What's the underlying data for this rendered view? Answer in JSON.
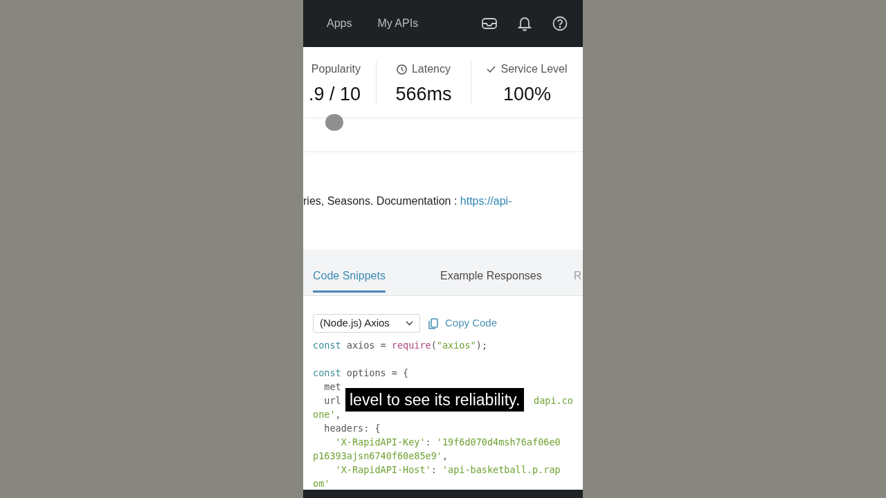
{
  "nav": {
    "links": [
      "Apps",
      "My APIs"
    ]
  },
  "stats": [
    {
      "kind": "plain",
      "label": "Popularity",
      "value": ".9 / 10"
    },
    {
      "kind": "clock",
      "label": "Latency",
      "value": "566ms"
    },
    {
      "kind": "check",
      "label": "Service Level",
      "value": "100%"
    }
  ],
  "description": {
    "text": "ries, Seasons. Documentation : ",
    "link": "https://api-"
  },
  "tabs": [
    {
      "label": "Code Snippets",
      "selected": true
    },
    {
      "label": "Example Responses",
      "selected": false
    },
    {
      "label": "R",
      "selected": false
    }
  ],
  "language_select": {
    "value": "(Node.js) Axios"
  },
  "copy_button": "Copy Code",
  "code_lines": [
    {
      "kind": "code",
      "segments": [
        {
          "kind": "keyword",
          "text": "const"
        },
        {
          "kind": "plain",
          "text": " axios = "
        },
        {
          "kind": "function",
          "text": "require"
        },
        {
          "kind": "plain",
          "text": "("
        },
        {
          "kind": "string",
          "text": "\"axios\""
        },
        {
          "kind": "plain",
          "text": ");"
        }
      ]
    },
    {
      "kind": "blank"
    },
    {
      "kind": "code",
      "segments": [
        {
          "kind": "keyword",
          "text": "const"
        },
        {
          "kind": "plain",
          "text": " options = {"
        }
      ]
    },
    {
      "kind": "code",
      "segments": [
        {
          "kind": "plain",
          "text": "  met"
        }
      ]
    },
    {
      "kind": "split",
      "segments": [
        {
          "kind": "plain",
          "text": "  url"
        },
        {
          "kind": "string",
          "text": "dapi.co"
        }
      ]
    },
    {
      "kind": "code",
      "segments": [
        {
          "kind": "string",
          "text": "one'"
        },
        {
          "kind": "plain",
          "text": ","
        }
      ]
    },
    {
      "kind": "code",
      "segments": [
        {
          "kind": "plain",
          "text": "  headers: {"
        }
      ]
    },
    {
      "kind": "code",
      "segments": [
        {
          "kind": "string",
          "text": "    'X-RapidAPI-Key'"
        },
        {
          "kind": "plain",
          "text": ": "
        },
        {
          "kind": "string",
          "text": "'19f6d070d4msh76af06e0"
        }
      ]
    },
    {
      "kind": "code",
      "segments": [
        {
          "kind": "string",
          "text": "p16393ajsn6740f60e85e9'"
        },
        {
          "kind": "plain",
          "text": ","
        }
      ]
    },
    {
      "kind": "code",
      "segments": [
        {
          "kind": "string",
          "text": "    'X-RapidAPI-Host'"
        },
        {
          "kind": "plain",
          "text": ": "
        },
        {
          "kind": "string",
          "text": "'api-basketball.p.rap"
        }
      ]
    },
    {
      "kind": "code",
      "segments": [
        {
          "kind": "string",
          "text": "om'"
        }
      ]
    }
  ],
  "caption": "level to see its reliability."
}
